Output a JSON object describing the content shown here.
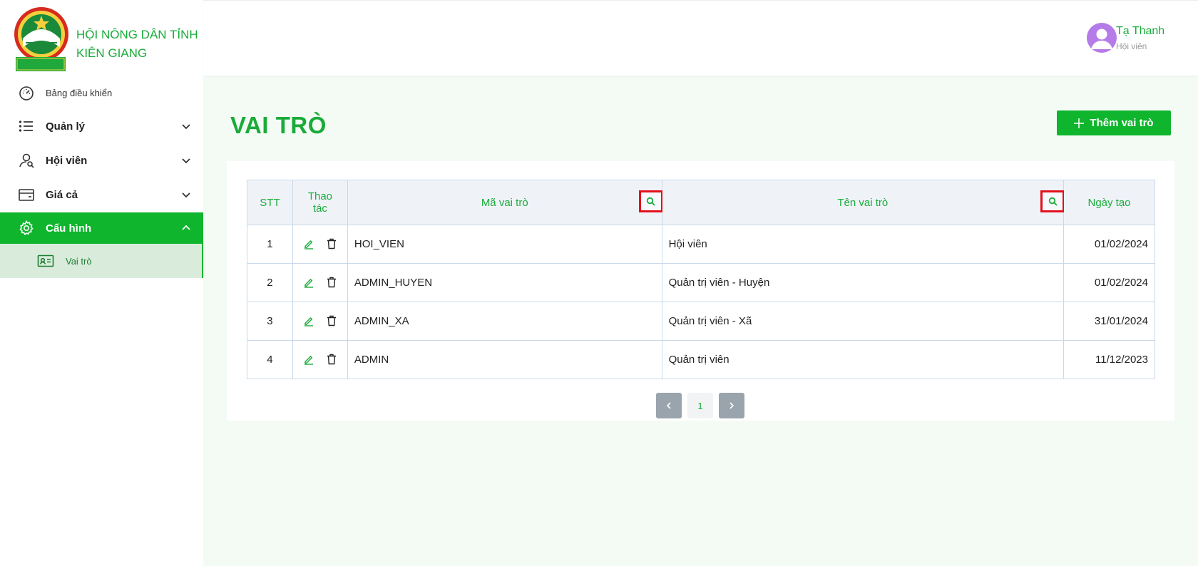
{
  "brand": {
    "line1": "HỘI NÔNG DÂN TỈNH",
    "line2": "KIÊN GIANG",
    "logo_text": "HỘI NÔNG DÂN TỈNH KIÊN GIANG"
  },
  "sidebar": {
    "dashboard": "Bảng điều khiển",
    "items": [
      {
        "label": "Quản lý"
      },
      {
        "label": "Hội viên"
      },
      {
        "label": "Giá cả"
      },
      {
        "label": "Cấu hình"
      }
    ],
    "sub_item": "Vai trò"
  },
  "user": {
    "name": "Tạ Thanh",
    "role": "Hội viên"
  },
  "page": {
    "title": "VAI TRÒ",
    "add_button": "Thêm vai trò"
  },
  "table": {
    "headers": {
      "stt": "STT",
      "actions_1": "Thao",
      "actions_2": "tác",
      "code": "Mã vai trò",
      "name": "Tên vai trò",
      "date": "Ngày tạo"
    },
    "rows": [
      {
        "stt": "1",
        "code": "HOI_VIEN",
        "name": "Hội viên",
        "date": "01/02/2024"
      },
      {
        "stt": "2",
        "code": "ADMIN_HUYEN",
        "name": "Quản trị viên - Huyện",
        "date": "01/02/2024"
      },
      {
        "stt": "3",
        "code": "ADMIN_XA",
        "name": "Quản trị viên - Xã",
        "date": "31/01/2024"
      },
      {
        "stt": "4",
        "code": "ADMIN",
        "name": "Quản trị viên",
        "date": "11/12/2023"
      }
    ]
  },
  "pagination": {
    "current": "1"
  },
  "colors": {
    "accent": "#0fb52d",
    "accent_text": "#1aab3a",
    "highlight": "#e3101b",
    "avatar": "#b57be8"
  },
  "icons": [
    "logo",
    "dashboard-icon",
    "list-icon",
    "users-icon",
    "card-icon",
    "gear-icon",
    "id-card-icon",
    "chevron-down-icon",
    "chevron-up-icon",
    "plus-icon",
    "search-icon",
    "edit-icon",
    "trash-icon",
    "chevron-left-icon",
    "chevron-right-icon",
    "user-avatar"
  ]
}
